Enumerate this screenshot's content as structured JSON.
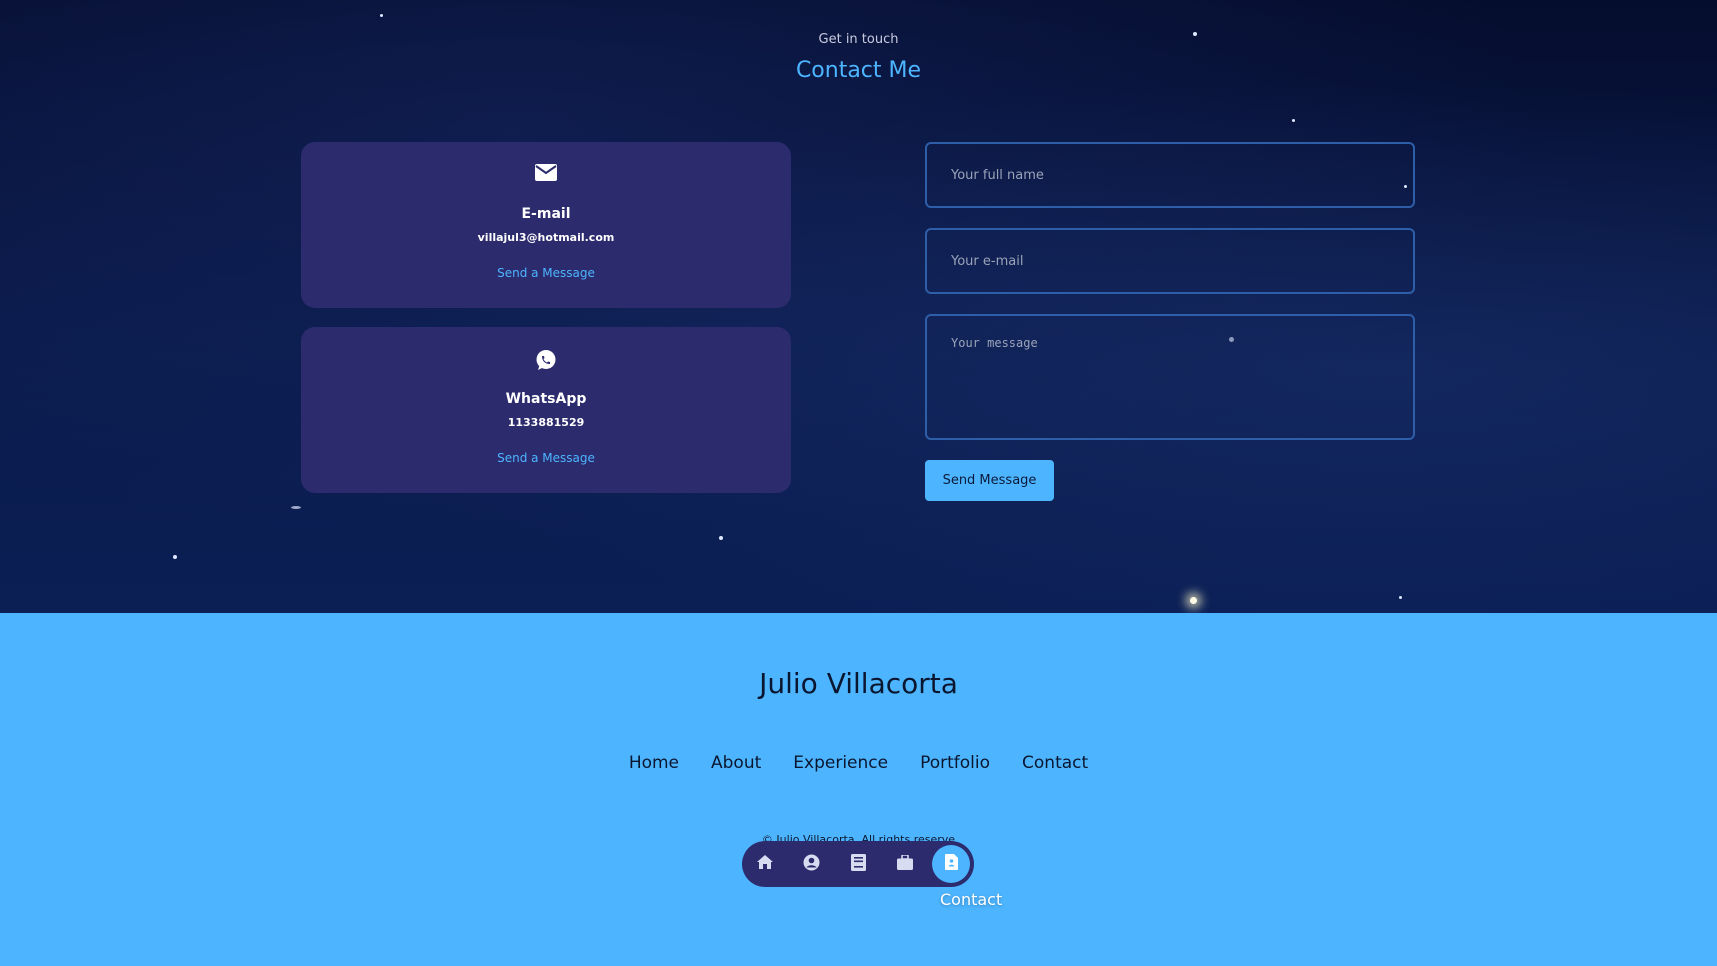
{
  "contact": {
    "subtitle": "Get in touch",
    "title": "Contact Me",
    "cards": [
      {
        "icon": "mail-icon",
        "name": "E-mail",
        "value": "villajul3@hotmail.com",
        "link": "Send a Message"
      },
      {
        "icon": "whatsapp-icon",
        "name": "WhatsApp",
        "value": "1133881529",
        "link": "Send a Message"
      }
    ],
    "form": {
      "name_placeholder": "Your full name",
      "email_placeholder": "Your e-mail",
      "message_placeholder": "Your message",
      "submit_label": "Send Message"
    }
  },
  "footer": {
    "name": "Julio Villacorta",
    "links": [
      "Home",
      "About",
      "Experience",
      "Portfolio",
      "Contact"
    ],
    "copyright": "© Julio Villacorta. All rights reserve"
  },
  "bottom_nav": {
    "items": [
      {
        "icon": "home-icon"
      },
      {
        "icon": "user-circle-icon"
      },
      {
        "icon": "book-icon"
      },
      {
        "icon": "briefcase-icon"
      },
      {
        "icon": "contact-file-icon"
      }
    ],
    "active_index": 4,
    "tooltip": "Contact"
  },
  "colors": {
    "accent": "#4db5ff",
    "card_bg": "#2c2b6e",
    "footer_bg": "#4db5ff",
    "section_bg": "#0a1a4a"
  }
}
